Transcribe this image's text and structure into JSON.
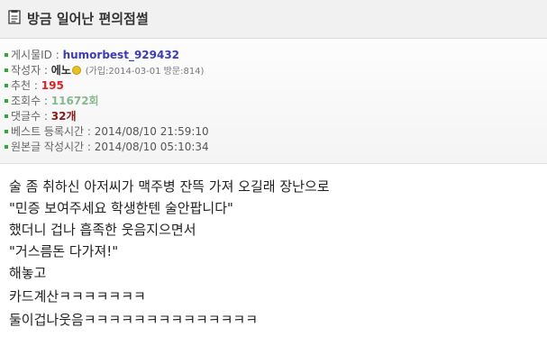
{
  "header": {
    "title": "방금 일어난 편의점썰",
    "icon": "document-icon"
  },
  "meta": {
    "post_id": {
      "label": "게시물ID",
      "value": "humorbest_929432"
    },
    "author": {
      "label": "작성자",
      "value": "에노",
      "detail": "(가입:2014-03-01 방문:814)"
    },
    "recommend": {
      "label": "추천",
      "value": "195"
    },
    "views": {
      "label": "조회수",
      "value": "11672회"
    },
    "comments": {
      "label": "댓글수",
      "value": "32개"
    },
    "best_time": {
      "label": "베스트 등록시간",
      "value": "2014/08/10 21:59:10"
    },
    "original_time": {
      "label": "원본글 작성시간",
      "value": "2014/08/10 05:10:34"
    },
    "separator": " : "
  },
  "content": {
    "lines": [
      "술 좀 취하신 아저씨가 맥주병 잔뜩 가져 오길래 장난으로",
      "\"민증 보여주세요 학생한텐 술안팝니다\"",
      "했더니 겁나 흡족한 웃음지으면서",
      "\"거스름돈 다가져!\"",
      "해놓고",
      "카드계산ㅋㅋㅋㅋㅋㅋㅋ",
      "둘이겁나웃음ㅋㅋㅋㅋㅋㅋㅋㅋㅋㅋㅋㅋㅋㅋ"
    ]
  },
  "colors": {
    "bullet": "#2eaa3a",
    "post_id": "#3c3cb4",
    "recommend": "#e02020",
    "views": "#88b890",
    "comments": "#8a1a1a"
  }
}
